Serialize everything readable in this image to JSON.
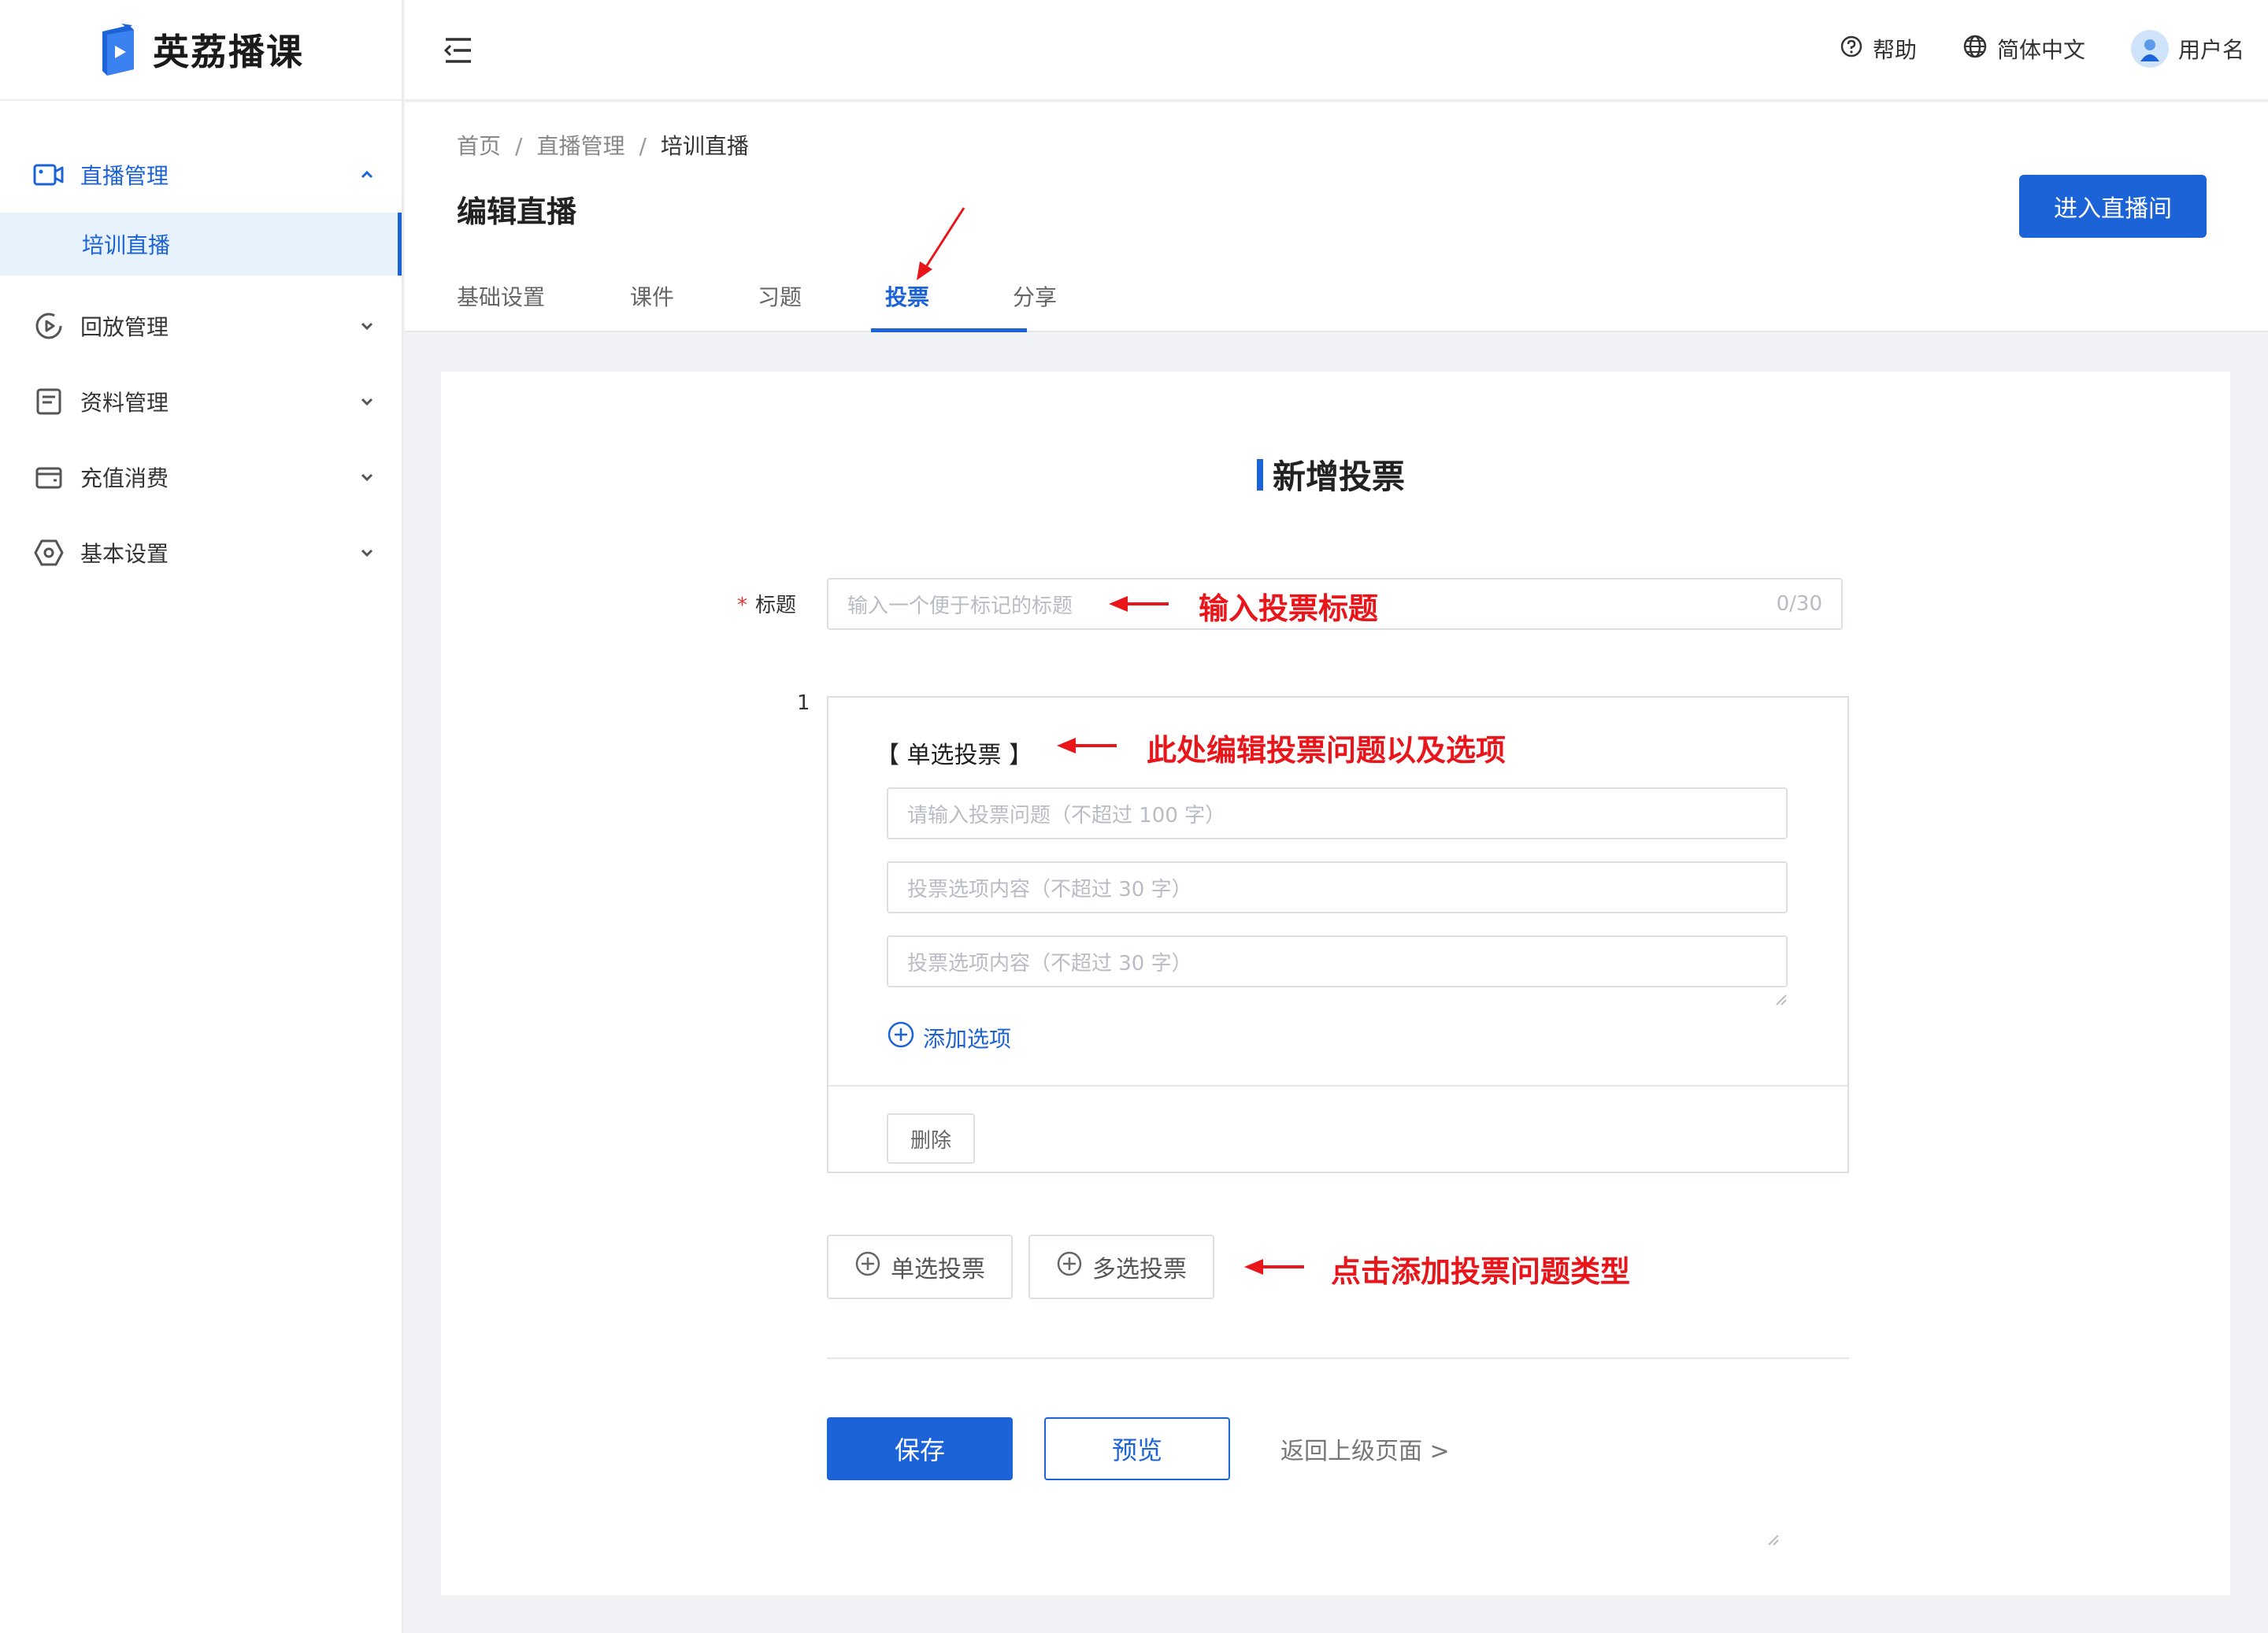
{
  "brand": {
    "name": "英荔播课"
  },
  "sidebar": {
    "items": [
      {
        "label": "直播管理",
        "icon": "video-camera-icon",
        "expanded": true,
        "children": [
          {
            "label": "培训直播",
            "active": true
          }
        ]
      },
      {
        "label": "回放管理",
        "icon": "replay-icon"
      },
      {
        "label": "资料管理",
        "icon": "document-icon"
      },
      {
        "label": "充值消费",
        "icon": "wallet-icon"
      },
      {
        "label": "基本设置",
        "icon": "settings-icon"
      }
    ]
  },
  "header": {
    "help": "帮助",
    "language": "简体中文",
    "username": "用户名"
  },
  "breadcrumb": [
    "首页",
    "直播管理",
    "培训直播"
  ],
  "page": {
    "title": "编辑直播",
    "enter_button": "进入直播间",
    "tabs": [
      "基础设置",
      "课件",
      "习题",
      "投票",
      "分享"
    ],
    "active_tab": "投票"
  },
  "form": {
    "heading": "新增投票",
    "title_label": "标题",
    "title_placeholder": "输入一个便于标记的标题",
    "title_counter": "0/30",
    "poll_index": "1",
    "poll_type": "【 单选投票 】",
    "question_placeholder": "请输入投票问题（不超过 100 字）",
    "option_placeholders": [
      "投票选项内容（不超过 30 字）",
      "投票选项内容（不超过 30 字）"
    ],
    "add_option": "添加选项",
    "delete": "删除",
    "single_choice": "单选投票",
    "multi_choice": "多选投票",
    "save": "保存",
    "preview": "预览",
    "back": "返回上级页面 >"
  },
  "annotations": {
    "title_hint": "输入投票标题",
    "poll_hint": "此处编辑投票问题以及选项",
    "type_hint": "点击添加投票问题类型"
  },
  "colors": {
    "primary": "#1d63d8",
    "annotation": "#e8151b"
  }
}
